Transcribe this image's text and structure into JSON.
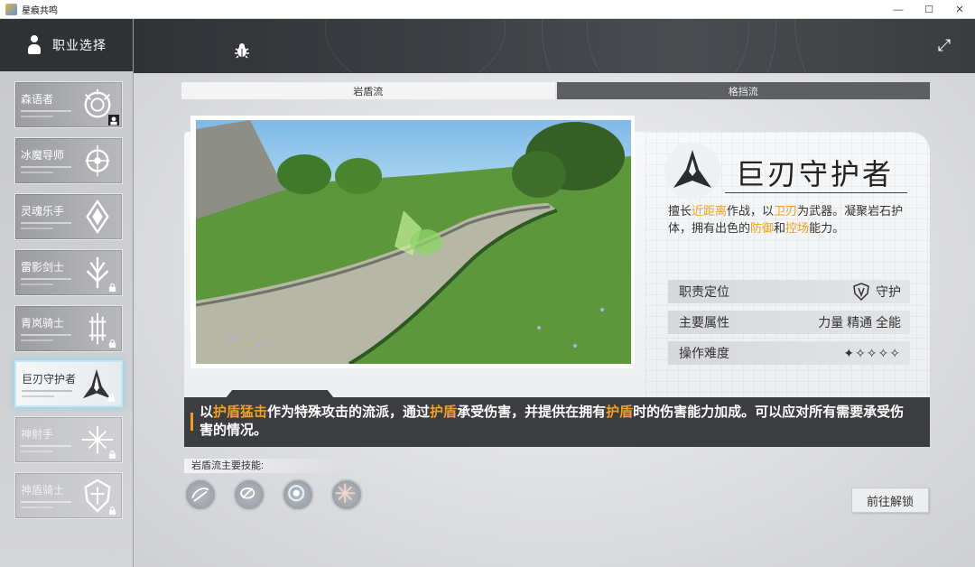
{
  "window": {
    "title": "星痕共鸣"
  },
  "sidebar": {
    "header": "职业选择",
    "items": [
      {
        "label": "森语者",
        "icon": "leaf-crest-icon",
        "badge": "owned-icon"
      },
      {
        "label": "冰魔导师",
        "icon": "ice-crest-icon"
      },
      {
        "label": "灵魂乐手",
        "icon": "soul-crest-icon"
      },
      {
        "label": "雷影剑士",
        "icon": "thunder-crest-icon",
        "badge": "lock-icon"
      },
      {
        "label": "青岚骑士",
        "icon": "wind-crest-icon",
        "badge": "lock-icon"
      },
      {
        "label": "巨刃守护者",
        "icon": "blade-crest-icon",
        "badge": "lock-icon",
        "active": true
      },
      {
        "label": "神射手",
        "icon": "archer-crest-icon",
        "badge": "lock-icon"
      },
      {
        "label": "神盾骑士",
        "icon": "shield-crest-icon",
        "badge": "lock-icon"
      }
    ]
  },
  "tabs": [
    {
      "label": "岩盾流",
      "active": true
    },
    {
      "label": "格挡流",
      "active": false
    }
  ],
  "hero": {
    "name": "巨刃守护者",
    "desc": {
      "p1": "擅长",
      "h1": "近距离",
      "p2": "作战，以",
      "h2": "卫刃",
      "p3": "为武器。凝聚岩石护体，拥有出色的",
      "h3": "防御",
      "p4": "和",
      "h4": "控场",
      "p5": "能力。"
    },
    "attributes": [
      {
        "label": "职责定位",
        "value": "守护",
        "icon": "shield-role-icon"
      },
      {
        "label": "主要属性",
        "value": "力量 精通 全能"
      },
      {
        "label": "操作难度",
        "value": "✦✧✧✧✧",
        "rating": 1,
        "max": 5
      }
    ]
  },
  "banner": {
    "p1": "以",
    "h1": "护盾猛击",
    "p2": "作为特殊攻击的流派，通过",
    "h2": "护盾",
    "p3": "承受伤害，并提供在拥有",
    "h3": "护盾",
    "p4": "时的伤害能力加成。可以应对所有需要承受伤害的情况。"
  },
  "skills": {
    "label": "岩盾流主要技能:",
    "items": [
      "skill-slash-icon",
      "skill-guard-icon",
      "skill-vortex-icon",
      "skill-burst-icon"
    ]
  },
  "unlock_button": "前往解锁",
  "colors": {
    "highlight": "#f0a020",
    "active_glow": "#bfe8f5",
    "banner": "#3c3d41"
  }
}
